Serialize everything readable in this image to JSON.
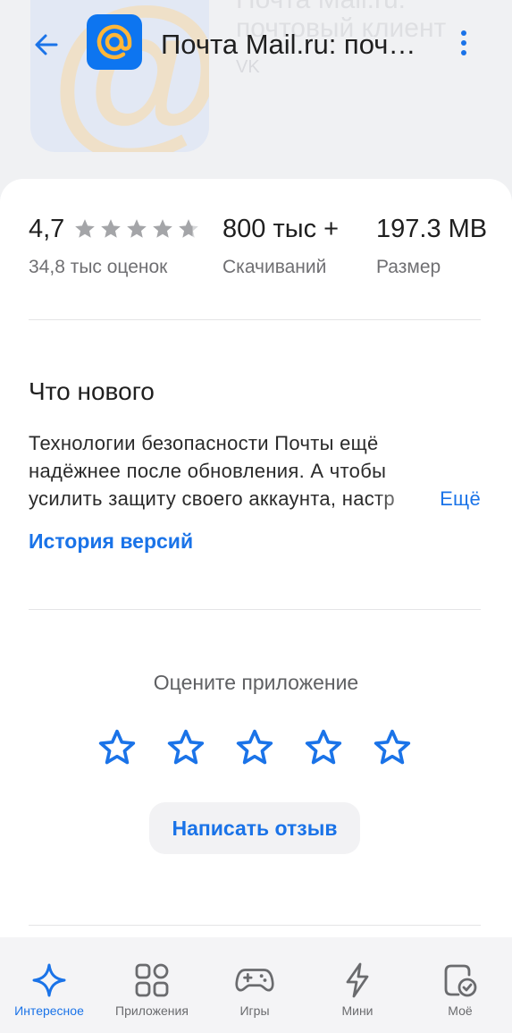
{
  "header": {
    "title": "Почта Mail.ru: почтовый клиент",
    "background_title_line1": "Почта Mail.ru:",
    "background_title_line2": "почтовый клиент",
    "developer": "VK",
    "app_icon": "mail-at-icon",
    "accent_color": "#1a73e8",
    "app_icon_color": "#0d75f0"
  },
  "stats": {
    "rating_value": "4,7",
    "rating_stars": 4.7,
    "rating_label": "34,8 тыс оценок",
    "downloads_value": "800 тыс +",
    "downloads_label": "Скачиваний",
    "size_value": "197.3 MB",
    "size_label": "Размер"
  },
  "whats_new": {
    "title": "Что нового",
    "line1": "Технологии безопасности Почты ещё",
    "line2": "надёжнее после обновления. А чтобы",
    "line3": "усилить защиту своего аккаунта, настр",
    "more": "Ещё",
    "history": "История версий"
  },
  "rate": {
    "title": "Оцените приложение",
    "stars": 5,
    "review_button": "Написать отзыв"
  },
  "nav": {
    "items": [
      {
        "label": "Интересное",
        "icon": "sparkle-icon",
        "active": true
      },
      {
        "label": "Приложения",
        "icon": "apps-grid-icon",
        "active": false
      },
      {
        "label": "Игры",
        "icon": "gamepad-icon",
        "active": false
      },
      {
        "label": "Мини",
        "icon": "lightning-icon",
        "active": false
      },
      {
        "label": "Моё",
        "icon": "my-apps-icon",
        "active": false
      }
    ]
  }
}
